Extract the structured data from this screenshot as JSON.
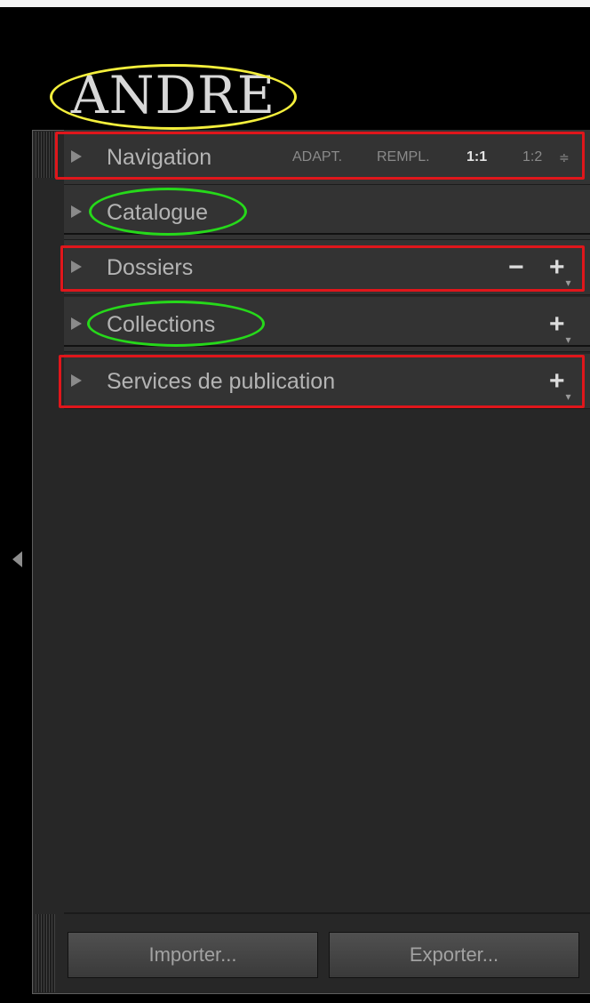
{
  "catalog": {
    "name": "ANDRE"
  },
  "panels": {
    "navigation": {
      "title": "Navigation",
      "zoom_options": [
        "ADAPT.",
        "REMPL.",
        "1:1",
        "1:2"
      ],
      "selected_zoom": "1:1",
      "stepper_glyph": "≑"
    },
    "catalogue": {
      "title": "Catalogue"
    },
    "dossiers": {
      "title": "Dossiers",
      "minus_glyph": "−",
      "plus_glyph": "+"
    },
    "collections": {
      "title": "Collections",
      "plus_glyph": "+"
    },
    "publish_services": {
      "title": "Services de publication",
      "plus_glyph": "+"
    }
  },
  "footer": {
    "import_label": "Importer...",
    "export_label": "Exporter..."
  },
  "icons": {
    "disclosure": "triangle-right-icon",
    "collapse": "triangle-left-icon",
    "add": "plus-icon",
    "remove": "minus-icon",
    "stepper": "up-down-stepper-icon"
  },
  "annotation_colors": {
    "red": "#e0161b",
    "green": "#26d91a",
    "yellow": "#f4ef3c"
  }
}
